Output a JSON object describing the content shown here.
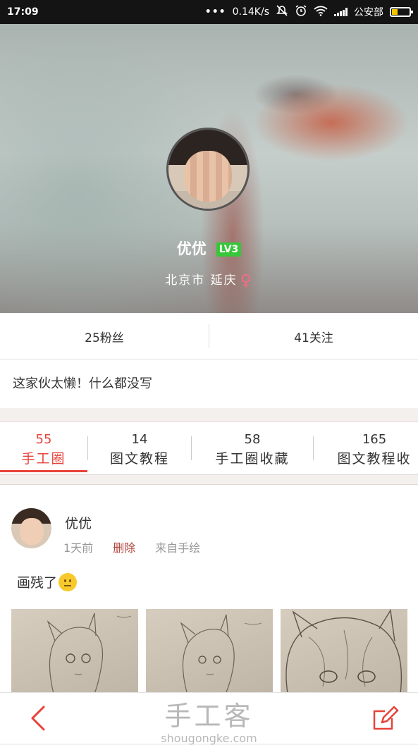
{
  "status_bar": {
    "time": "17:09",
    "network_speed": "0.14K/s",
    "carrier": "公安部",
    "icons": [
      "more-dots-icon",
      "mute-icon",
      "alarm-icon",
      "wifi-icon",
      "signal-icon",
      "battery-icon"
    ],
    "battery_level": 0.35,
    "colors": {
      "battery": "#f2c500"
    }
  },
  "profile": {
    "username": "优优",
    "level": "LV3",
    "location": "北京市 延庆",
    "gender_symbol": "♀",
    "colors": {
      "level_badge": "#38c63a",
      "gender": "#f06e87"
    }
  },
  "stats": {
    "fans": "25粉丝",
    "following": "41关注"
  },
  "bio": "这家伙太懒！什么都没写",
  "tabs": [
    {
      "count": "55",
      "label": "手工圈",
      "active": true
    },
    {
      "count": "14",
      "label": "图文教程",
      "active": false
    },
    {
      "count": "58",
      "label": "手工圈收藏",
      "active": false
    },
    {
      "count": "165",
      "label": "图文教程收",
      "active": false
    }
  ],
  "accent_color": "#e8423a",
  "post": {
    "author": "优优",
    "time": "1天前",
    "delete_label": "删除",
    "source": "来自手绘",
    "text": "画残了",
    "emoji": "confused-face-emoji",
    "images": [
      "sketch-drawing-1",
      "sketch-drawing-2",
      "sketch-drawing-3"
    ]
  },
  "bottom_bar": {
    "back_icon": "chevron-left-icon",
    "edit_icon": "edit-icon",
    "watermark_cn": "手工客",
    "watermark_url": "shougongke.com"
  }
}
